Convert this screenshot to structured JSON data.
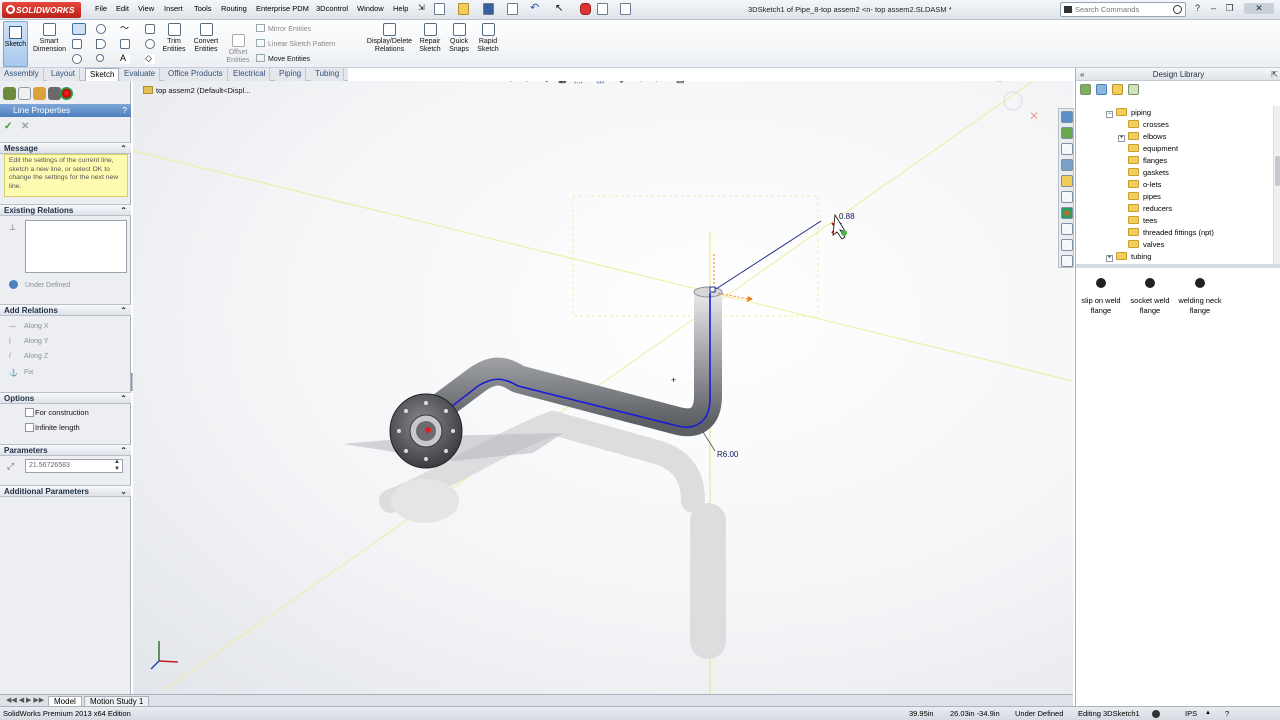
{
  "app": {
    "logo": "SOLIDWORKS"
  },
  "menu": [
    "File",
    "Edit",
    "View",
    "Insert",
    "Tools",
    "Routing",
    "Enterprise PDM",
    "3Dcontrol",
    "Window",
    "Help"
  ],
  "doc_title": "3DSketch1 of Pipe_8-top assem2 <n- top assem2.SLDASM *",
  "search": {
    "placeholder": "Search Commands"
  },
  "toolbar": {
    "sketch": "Sketch",
    "smart_dimension": "Smart Dimension",
    "trim": "Trim Entities",
    "convert": "Convert Entities",
    "offset": "Offset Entities",
    "mirror": "Mirror Entities",
    "linear_pattern": "Linear Sketch Pattern",
    "move": "Move Entities",
    "display_delete": "Display/Delete Relations",
    "repair": "Repair Sketch",
    "quick_snaps": "Quick Snaps",
    "rapid": "Rapid Sketch"
  },
  "tabs": [
    "Assembly",
    "Layout",
    "Sketch",
    "Evaluate",
    "Office Products",
    "Electrical",
    "Piping",
    "Tubing"
  ],
  "active_tab": "Sketch",
  "property_manager": {
    "title": "Line Properties",
    "message_header": "Message",
    "message": "Edit the settings of the current line, sketch a new line, or select OK to change the settings for the next new line.",
    "existing_relations": "Existing Relations",
    "status": "Under Defined",
    "add_relations": "Add Relations",
    "relations": [
      "Along X",
      "Along Y",
      "Along Z",
      "Fix"
    ],
    "options": "Options",
    "for_construction": "For construction",
    "infinite_length": "Infinite length",
    "parameters": "Parameters",
    "length_value": "21.56726583",
    "additional_parameters": "Additional Parameters"
  },
  "viewport": {
    "tree_node": "top assem2  (Default<Displ...",
    "dim_radius": "R6.00",
    "dim_cursor": "0.88"
  },
  "bottom_tabs": [
    "Model",
    "Motion Study 1"
  ],
  "status_bar": {
    "edition": "SolidWorks Premium 2013 x64 Edition",
    "coord1": "39.95in",
    "coord2": "26.03in -34.9in",
    "state": "Under Defined",
    "editing": "Editing 3DSketch1",
    "units": "IPS"
  },
  "design_library": {
    "title": "Design Library",
    "tree": [
      {
        "label": "piping",
        "level": 0,
        "expanded": true
      },
      {
        "label": "crosses",
        "level": 1
      },
      {
        "label": "elbows",
        "level": 1
      },
      {
        "label": "equipment",
        "level": 1
      },
      {
        "label": "flanges",
        "level": 1
      },
      {
        "label": "gaskets",
        "level": 1
      },
      {
        "label": "o-lets",
        "level": 1
      },
      {
        "label": "pipes",
        "level": 1
      },
      {
        "label": "reducers",
        "level": 1
      },
      {
        "label": "tees",
        "level": 1
      },
      {
        "label": "threaded fittings (npt)",
        "level": 1
      },
      {
        "label": "valves",
        "level": 1
      },
      {
        "label": "tubing",
        "level": 0,
        "expanded": false
      }
    ],
    "items": [
      "slip on weld flange",
      "socket weld flange",
      "welding neck flange"
    ]
  },
  "colors": {
    "accent": "#4d7fbe",
    "message_bg": "#fdfbb0",
    "sketch_line": "#1c1cd6",
    "pipe": "#9a9ca0"
  }
}
